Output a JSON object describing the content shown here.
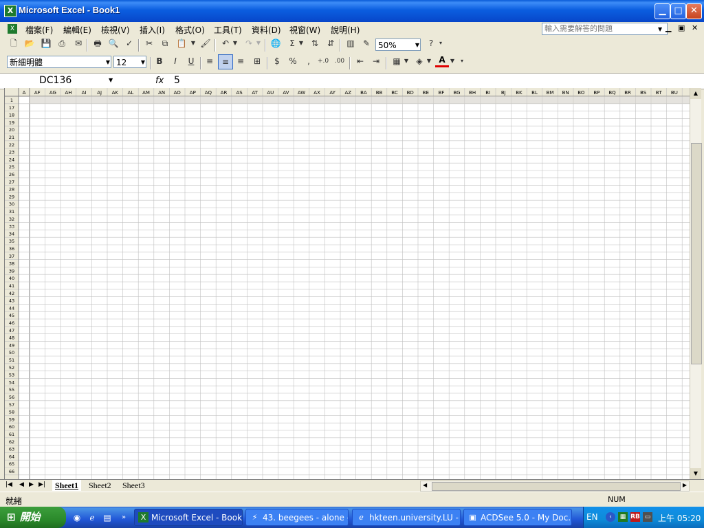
{
  "window": {
    "title": "Microsoft Excel - Book1",
    "app_icon": "X",
    "minimize": "▁",
    "maximize": "□",
    "close": "✕"
  },
  "menu": {
    "items": [
      "檔案(F)",
      "編輯(E)",
      "檢視(V)",
      "插入(I)",
      "格式(O)",
      "工具(T)",
      "資料(D)",
      "視窗(W)",
      "說明(H)"
    ],
    "help_placeholder": "輸入需要解答的問題"
  },
  "toolbar": {
    "zoom": "50%",
    "font_name": "新細明體",
    "font_size": "12",
    "bold": "B",
    "italic": "I",
    "underline": "U",
    "currency": "$",
    "percent": "%",
    "comma": ",",
    "font_color_letter": "A"
  },
  "formula": {
    "name_box": "DC136",
    "fx": "fx",
    "value": "5"
  },
  "grid": {
    "columns": [
      "A",
      "AF",
      "AG",
      "AH",
      "AI",
      "AJ",
      "AK",
      "AL",
      "AM",
      "AN",
      "AO",
      "AP",
      "AQ",
      "AR",
      "AS",
      "AT",
      "AU",
      "AV",
      "AW",
      "AX",
      "AY",
      "AZ",
      "BA",
      "BB",
      "BC",
      "BD",
      "BE",
      "BF",
      "BG",
      "BH",
      "BI",
      "BJ",
      "BK",
      "BL",
      "BM",
      "BN",
      "BO",
      "BP",
      "BQ",
      "BR",
      "BS",
      "BT",
      "BU"
    ],
    "rows": [
      "1",
      "17",
      "18",
      "19",
      "20",
      "21",
      "22",
      "23",
      "24",
      "25",
      "26",
      "27",
      "28",
      "29",
      "30",
      "31",
      "32",
      "33",
      "34",
      "35",
      "36",
      "37",
      "38",
      "39",
      "40",
      "41",
      "42",
      "43",
      "44",
      "45",
      "46",
      "47",
      "48",
      "49",
      "50",
      "51",
      "52",
      "53",
      "54",
      "55",
      "56",
      "57",
      "58",
      "59",
      "60",
      "61",
      "62",
      "63",
      "64",
      "65",
      "66"
    ]
  },
  "sheets": {
    "tabs": [
      "Sheet1",
      "Sheet2",
      "Sheet3"
    ],
    "active": "Sheet1"
  },
  "status": {
    "text": "就緒",
    "num": "NUM"
  },
  "taskbar": {
    "start": "開始",
    "tasks": [
      {
        "label": "Microsoft Excel - Book1",
        "icon": "excel-icon"
      },
      {
        "label": "43. beegees - alone - ...",
        "icon": "winamp-icon"
      },
      {
        "label": "hkteen.university.LU - ...",
        "icon": "ie-icon"
      },
      {
        "label": "ACDSee 5.0 - My Doc...",
        "icon": "acdsee-icon"
      }
    ],
    "lang": "EN",
    "clock": "上午 05:20"
  }
}
